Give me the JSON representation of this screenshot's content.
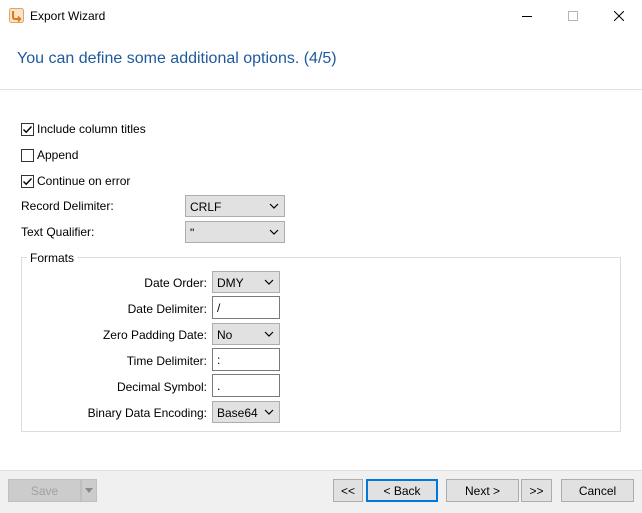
{
  "window": {
    "title": "Export Wizard"
  },
  "heading": "You can define some additional options. (4/5)",
  "options": {
    "include_column_titles": {
      "label": "Include column titles",
      "checked": true
    },
    "append": {
      "label": "Append",
      "checked": false
    },
    "continue_on_error": {
      "label": "Continue on error",
      "checked": true
    }
  },
  "record_delimiter": {
    "label": "Record Delimiter:",
    "value": "CRLF"
  },
  "text_qualifier": {
    "label": "Text Qualifier:",
    "value": "\""
  },
  "formats": {
    "title": "Formats",
    "date_order": {
      "label": "Date Order:",
      "value": "DMY"
    },
    "date_delimiter": {
      "label": "Date Delimiter:",
      "value": "/"
    },
    "zero_padding_date": {
      "label": "Zero Padding Date:",
      "value": "No"
    },
    "time_delimiter": {
      "label": "Time Delimiter:",
      "value": ":"
    },
    "decimal_symbol": {
      "label": "Decimal Symbol:",
      "value": "."
    },
    "binary_data_encoding": {
      "label": "Binary Data Encoding:",
      "value": "Base64"
    }
  },
  "buttons": {
    "save": "Save",
    "first": "<<",
    "back": "< Back",
    "next": "Next >",
    "last": ">>",
    "cancel": "Cancel"
  }
}
